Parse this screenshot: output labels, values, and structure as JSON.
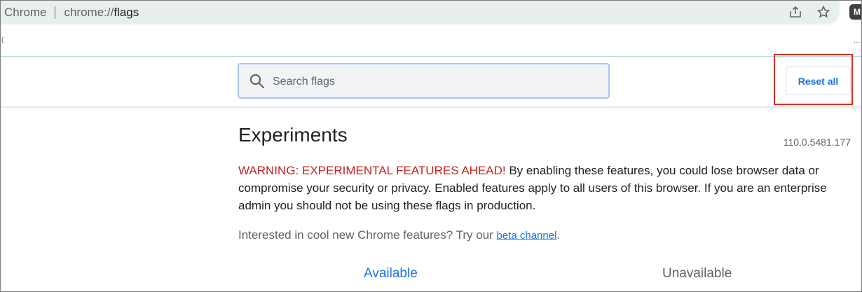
{
  "browser": {
    "site_label": "Chrome",
    "url_scheme": "chrome://",
    "url_path": "flags",
    "extension_badge": "M",
    "bookmark_edge_left": "(",
    "bookmark_edge_right": "..."
  },
  "header": {
    "search_placeholder": "Search flags",
    "reset_label": "Reset all"
  },
  "content": {
    "title": "Experiments",
    "version": "110.0.5481.177",
    "warning_label": "WARNING: EXPERIMENTAL FEATURES AHEAD!",
    "warning_text": " By enabling these features, you could lose browser data or compromise your security or privacy. Enabled features apply to all users of this browser. If you are an enterprise admin you should not be using these flags in production.",
    "interest_text": "Interested in cool new Chrome features? Try our ",
    "beta_link": "beta channel",
    "interest_end": "."
  },
  "tabs": [
    {
      "label": "Available"
    },
    {
      "label": "Unavailable"
    }
  ],
  "colors": {
    "accent": "#1a73e8",
    "warning": "#c5221f",
    "highlight": "#d93025"
  }
}
